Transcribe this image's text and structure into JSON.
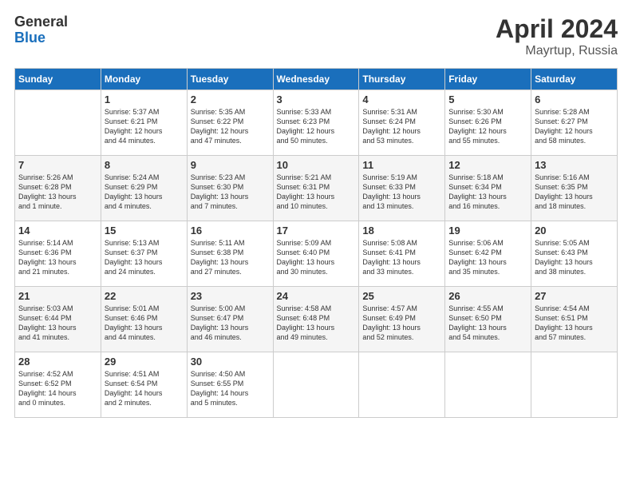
{
  "header": {
    "logo_general": "General",
    "logo_blue": "Blue",
    "month_title": "April 2024",
    "location": "Mayrtup, Russia"
  },
  "weekdays": [
    "Sunday",
    "Monday",
    "Tuesday",
    "Wednesday",
    "Thursday",
    "Friday",
    "Saturday"
  ],
  "weeks": [
    [
      {
        "day": "",
        "sunrise": "",
        "sunset": "",
        "daylight": ""
      },
      {
        "day": "1",
        "sunrise": "Sunrise: 5:37 AM",
        "sunset": "Sunset: 6:21 PM",
        "daylight": "Daylight: 12 hours and 44 minutes."
      },
      {
        "day": "2",
        "sunrise": "Sunrise: 5:35 AM",
        "sunset": "Sunset: 6:22 PM",
        "daylight": "Daylight: 12 hours and 47 minutes."
      },
      {
        "day": "3",
        "sunrise": "Sunrise: 5:33 AM",
        "sunset": "Sunset: 6:23 PM",
        "daylight": "Daylight: 12 hours and 50 minutes."
      },
      {
        "day": "4",
        "sunrise": "Sunrise: 5:31 AM",
        "sunset": "Sunset: 6:24 PM",
        "daylight": "Daylight: 12 hours and 53 minutes."
      },
      {
        "day": "5",
        "sunrise": "Sunrise: 5:30 AM",
        "sunset": "Sunset: 6:26 PM",
        "daylight": "Daylight: 12 hours and 55 minutes."
      },
      {
        "day": "6",
        "sunrise": "Sunrise: 5:28 AM",
        "sunset": "Sunset: 6:27 PM",
        "daylight": "Daylight: 12 hours and 58 minutes."
      }
    ],
    [
      {
        "day": "7",
        "sunrise": "Sunrise: 5:26 AM",
        "sunset": "Sunset: 6:28 PM",
        "daylight": "Daylight: 13 hours and 1 minute."
      },
      {
        "day": "8",
        "sunrise": "Sunrise: 5:24 AM",
        "sunset": "Sunset: 6:29 PM",
        "daylight": "Daylight: 13 hours and 4 minutes."
      },
      {
        "day": "9",
        "sunrise": "Sunrise: 5:23 AM",
        "sunset": "Sunset: 6:30 PM",
        "daylight": "Daylight: 13 hours and 7 minutes."
      },
      {
        "day": "10",
        "sunrise": "Sunrise: 5:21 AM",
        "sunset": "Sunset: 6:31 PM",
        "daylight": "Daylight: 13 hours and 10 minutes."
      },
      {
        "day": "11",
        "sunrise": "Sunrise: 5:19 AM",
        "sunset": "Sunset: 6:33 PM",
        "daylight": "Daylight: 13 hours and 13 minutes."
      },
      {
        "day": "12",
        "sunrise": "Sunrise: 5:18 AM",
        "sunset": "Sunset: 6:34 PM",
        "daylight": "Daylight: 13 hours and 16 minutes."
      },
      {
        "day": "13",
        "sunrise": "Sunrise: 5:16 AM",
        "sunset": "Sunset: 6:35 PM",
        "daylight": "Daylight: 13 hours and 18 minutes."
      }
    ],
    [
      {
        "day": "14",
        "sunrise": "Sunrise: 5:14 AM",
        "sunset": "Sunset: 6:36 PM",
        "daylight": "Daylight: 13 hours and 21 minutes."
      },
      {
        "day": "15",
        "sunrise": "Sunrise: 5:13 AM",
        "sunset": "Sunset: 6:37 PM",
        "daylight": "Daylight: 13 hours and 24 minutes."
      },
      {
        "day": "16",
        "sunrise": "Sunrise: 5:11 AM",
        "sunset": "Sunset: 6:38 PM",
        "daylight": "Daylight: 13 hours and 27 minutes."
      },
      {
        "day": "17",
        "sunrise": "Sunrise: 5:09 AM",
        "sunset": "Sunset: 6:40 PM",
        "daylight": "Daylight: 13 hours and 30 minutes."
      },
      {
        "day": "18",
        "sunrise": "Sunrise: 5:08 AM",
        "sunset": "Sunset: 6:41 PM",
        "daylight": "Daylight: 13 hours and 33 minutes."
      },
      {
        "day": "19",
        "sunrise": "Sunrise: 5:06 AM",
        "sunset": "Sunset: 6:42 PM",
        "daylight": "Daylight: 13 hours and 35 minutes."
      },
      {
        "day": "20",
        "sunrise": "Sunrise: 5:05 AM",
        "sunset": "Sunset: 6:43 PM",
        "daylight": "Daylight: 13 hours and 38 minutes."
      }
    ],
    [
      {
        "day": "21",
        "sunrise": "Sunrise: 5:03 AM",
        "sunset": "Sunset: 6:44 PM",
        "daylight": "Daylight: 13 hours and 41 minutes."
      },
      {
        "day": "22",
        "sunrise": "Sunrise: 5:01 AM",
        "sunset": "Sunset: 6:46 PM",
        "daylight": "Daylight: 13 hours and 44 minutes."
      },
      {
        "day": "23",
        "sunrise": "Sunrise: 5:00 AM",
        "sunset": "Sunset: 6:47 PM",
        "daylight": "Daylight: 13 hours and 46 minutes."
      },
      {
        "day": "24",
        "sunrise": "Sunrise: 4:58 AM",
        "sunset": "Sunset: 6:48 PM",
        "daylight": "Daylight: 13 hours and 49 minutes."
      },
      {
        "day": "25",
        "sunrise": "Sunrise: 4:57 AM",
        "sunset": "Sunset: 6:49 PM",
        "daylight": "Daylight: 13 hours and 52 minutes."
      },
      {
        "day": "26",
        "sunrise": "Sunrise: 4:55 AM",
        "sunset": "Sunset: 6:50 PM",
        "daylight": "Daylight: 13 hours and 54 minutes."
      },
      {
        "day": "27",
        "sunrise": "Sunrise: 4:54 AM",
        "sunset": "Sunset: 6:51 PM",
        "daylight": "Daylight: 13 hours and 57 minutes."
      }
    ],
    [
      {
        "day": "28",
        "sunrise": "Sunrise: 4:52 AM",
        "sunset": "Sunset: 6:52 PM",
        "daylight": "Daylight: 14 hours and 0 minutes."
      },
      {
        "day": "29",
        "sunrise": "Sunrise: 4:51 AM",
        "sunset": "Sunset: 6:54 PM",
        "daylight": "Daylight: 14 hours and 2 minutes."
      },
      {
        "day": "30",
        "sunrise": "Sunrise: 4:50 AM",
        "sunset": "Sunset: 6:55 PM",
        "daylight": "Daylight: 14 hours and 5 minutes."
      },
      {
        "day": "",
        "sunrise": "",
        "sunset": "",
        "daylight": ""
      },
      {
        "day": "",
        "sunrise": "",
        "sunset": "",
        "daylight": ""
      },
      {
        "day": "",
        "sunrise": "",
        "sunset": "",
        "daylight": ""
      },
      {
        "day": "",
        "sunrise": "",
        "sunset": "",
        "daylight": ""
      }
    ]
  ]
}
